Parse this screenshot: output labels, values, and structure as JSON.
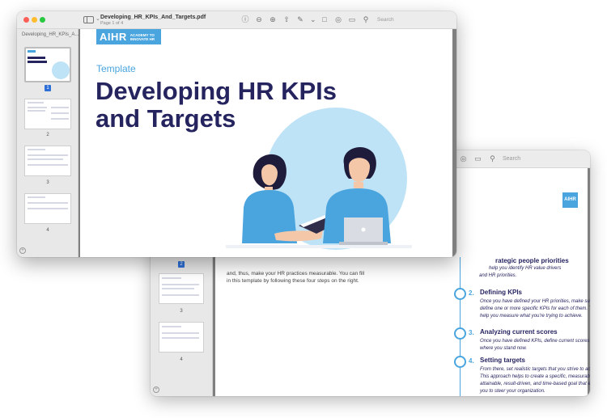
{
  "front_window": {
    "doc_title": "Developing_HR_KPIs_And_Targets.pdf",
    "doc_subtitle": "Page 1 of 4",
    "sidebar_title": "Developing_HR_KPIs_A...",
    "search_placeholder": "Search",
    "toolbar_icons": [
      "sidebar-icon",
      "info-icon",
      "zoom-out-icon",
      "zoom-in-icon",
      "share-icon",
      "markup-icon",
      "rotate-icon",
      "annotate-icon",
      "form-icon",
      "search-icon"
    ],
    "thumbnails": [
      {
        "page": "1",
        "selected": true
      },
      {
        "page": "2",
        "selected": false
      },
      {
        "page": "3",
        "selected": false
      },
      {
        "page": "4",
        "selected": false
      }
    ],
    "page": {
      "logo_text": "AIHR",
      "logo_subtext": "ACADEMY TO INNOVATE HR",
      "template_label": "Template",
      "title": "Developing HR KPIs and Targets"
    }
  },
  "back_window": {
    "search_placeholder": "Search",
    "thumbnails": [
      {
        "page": "2",
        "selected": true
      },
      {
        "page": "3",
        "selected": false
      },
      {
        "page": "4",
        "selected": false
      }
    ],
    "page": {
      "logo_text": "AIHR",
      "intro_text": "and, thus, make your HR practices measurable. You can fill in this template by following these four steps on the right.",
      "step1_title": "rategic people priorities",
      "step1_body_a": "help you identify HR value drivers",
      "step1_body_b": "and HR priorities.",
      "steps": [
        {
          "num": "2.",
          "title": "Defining KPIs",
          "body": "Once you have defined your HR priorities, make sure to define one or more specific KPIs for each of them. These help you measure what you're trying to achieve."
        },
        {
          "num": "3.",
          "title": "Analyzing current scores",
          "body": "Once you have defined KPIs, define current scores to see where you stand now."
        },
        {
          "num": "4.",
          "title": "Setting targets",
          "body": "From there, set realistic targets that you strive to achieve. This approach helps to create a specific, measurable, attainable, result-driven, and time-based goal that enables you to steer your organization."
        }
      ]
    }
  },
  "colors": {
    "accent": "#4aa5df",
    "navy": "#26245f",
    "circle": "#bfe3f6",
    "selected": "#2d6fd6"
  }
}
